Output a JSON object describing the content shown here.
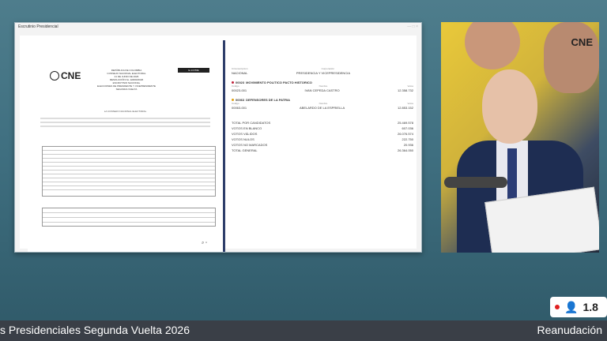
{
  "window": {
    "title": "Escrutinio Presidencial",
    "close_icon": "close-icon"
  },
  "document": {
    "logo_text": "CNE",
    "header_lines": [
      "REPÚBLICA DE COLOMBIA",
      "CONSEJO NACIONAL ELECTORAL",
      "21 DE JUNIO DE 2026",
      "RESOLUCIÓN No. E0000/2026",
      "ESCRUTINIO NACIONAL",
      "ELECCIONES DE PRESIDENTE Y VICEPRESIDENTE",
      "SEGUNDA VUELTA"
    ],
    "badge": "E-14 PRE",
    "intro_line": "LA CONSEJO NACIONAL ELECTORAL"
  },
  "results": {
    "header": {
      "circ_label": "Circunscripción",
      "circ_value": "NACIONAL",
      "corp_label": "Corporación",
      "corp_value": "PRESIDENCIA Y VICEPRESIDENCIA"
    },
    "parties": [
      {
        "code": "00023",
        "name": "MOVIMIENTO POLITICO PACTO HISTORICO",
        "color": "#c0203a",
        "cand_code": "00023-001",
        "cand_name": "IVAN CEPEDA CASTRO",
        "votes": "12.358.732"
      },
      {
        "code": "00063",
        "name": "DEFENSORES DE LA PATRIA",
        "color": "#e0a010",
        "cand_code": "00063-001",
        "cand_name": "ABELARDO DE LA ESPRIELLA",
        "votes": "12.853.152"
      }
    ],
    "col_code": "Código",
    "col_name": "Nombre",
    "col_votes": "Votos",
    "totals": [
      {
        "label": "TOTAL POR CANDIDATOS",
        "value": "25.469.578"
      },
      {
        "label": "VOTOS EN BLANCO",
        "value": "607.036"
      },
      {
        "label": "VOTOS VÁLIDOS",
        "value": "26.076.574"
      },
      {
        "label": "VOTOS NULOS",
        "value": "222.750"
      },
      {
        "label": "VOTOS NO MARCADOS",
        "value": "20.936"
      },
      {
        "label": "TOTAL GENERAL",
        "value": "26.364.050"
      }
    ]
  },
  "watermark": "CNE",
  "viewers": "1.8",
  "ticker": {
    "left": "s Presidenciales Segunda Vuelta 2026",
    "right": "Reanudación"
  }
}
